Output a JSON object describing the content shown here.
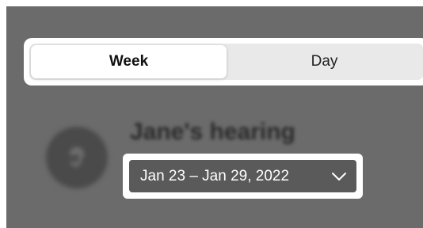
{
  "segmented": {
    "options": [
      "Week",
      "Day"
    ],
    "selected": "Week"
  },
  "profile": {
    "title": "Jane's hearing",
    "icon": "ear-icon"
  },
  "date_range": {
    "label": "Jan 23 – Jan 29, 2022",
    "icon": "chevron-down-icon"
  },
  "colors": {
    "overlay": "#6b6b6b",
    "pill": "#5a5a5a"
  }
}
